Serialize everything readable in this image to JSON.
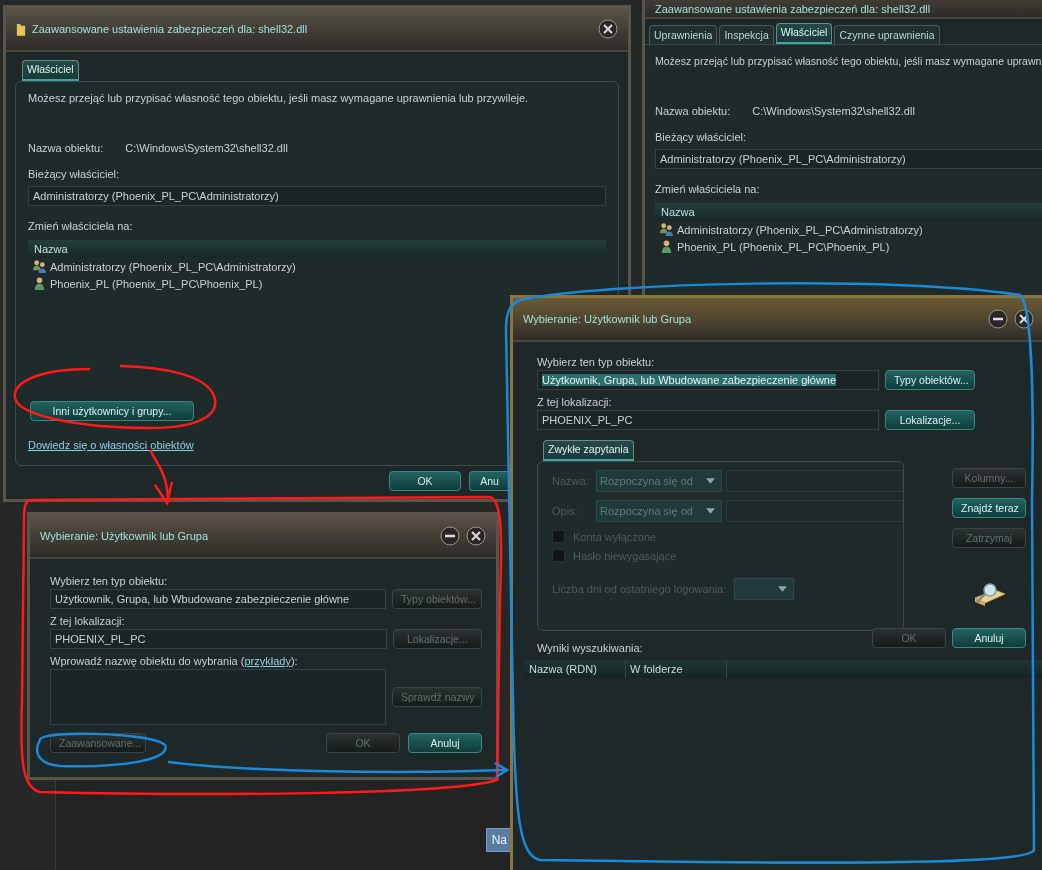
{
  "main_window": {
    "title": "Zaawansowane ustawienia zabezpieczeń dla: shell32.dll",
    "tabs": [
      {
        "label": "Właściciel",
        "selected": true
      }
    ],
    "description": "Możesz przejąć lub przypisać własność tego obiektu, jeśli masz wymagane uprawnienia lub przywileje.",
    "object_name_label": "Nazwa obiektu:",
    "object_name_value": "C:\\Windows\\System32\\shell32.dll",
    "current_owner_label": "Bieżący właściciel:",
    "current_owner_value": "Administratorzy (Phoenix_PL_PC\\Administratorzy)",
    "change_owner_label": "Zmień właściciela na:",
    "list_header": "Nazwa",
    "owners": [
      {
        "name": "Administratorzy (Phoenix_PL_PC\\Administratorzy)",
        "kind": "group"
      },
      {
        "name": "Phoenix_PL (Phoenix_PL_PC\\Phoenix_PL)",
        "kind": "user"
      }
    ],
    "other_users_button": "Inni użytkownicy i grupy...",
    "learn_link": "Dowiedz się o własności obiektów",
    "buttons": [
      "OK",
      "Anu"
    ]
  },
  "background_window": {
    "title": "Zaawansowane ustawienia zabezpieczeń dla: shell32.dll",
    "tabs": [
      {
        "label": "Uprawnienia",
        "selected": false
      },
      {
        "label": "Inspekcja",
        "selected": false
      },
      {
        "label": "Właściciel",
        "selected": true
      },
      {
        "label": "Czynne uprawnienia",
        "selected": false
      }
    ],
    "description": "Możesz przejąć lub przypisać własność tego obiektu, jeśli masz wymagane uprawn",
    "object_name_label": "Nazwa obiektu:",
    "object_name_value": "C:\\Windows\\System32\\shell32.dll",
    "current_owner_label": "Bieżący właściciel:",
    "current_owner_value": "Administratorzy (Phoenix_PL_PC\\Administratorzy)",
    "change_owner_label": "Zmień właściciela na:",
    "list_header": "Nazwa",
    "owners": [
      {
        "name": "Administratorzy (Phoenix_PL_PC\\Administratorzy)",
        "kind": "group"
      },
      {
        "name": "Phoenix_PL (Phoenix_PL_PC\\Phoenix_PL)",
        "kind": "user"
      }
    ]
  },
  "behind_window": {
    "button": "Na"
  },
  "small_select_dialog": {
    "title": "Wybieranie: Użytkownik lub Grupa",
    "object_type_label": "Wybierz ten typ obiektu:",
    "object_type_value": "Użytkownik, Grupa, lub Wbudowane zabezpieczenie główne",
    "object_types_button": {
      "label": "Typy obiektów...",
      "disabled": true
    },
    "location_label": "Z tej lokalizacji:",
    "location_value": "PHOENIX_PL_PC",
    "locations_button": {
      "label": "Lokalizacje...",
      "disabled": true
    },
    "names_label": "Wprowadź nazwę obiektu do wybrania (",
    "examples_link": "przykłady",
    "names_label_end": "):",
    "check_names_button": {
      "label": "Sprawdź nazwy",
      "disabled": true
    },
    "advanced_button": {
      "label": "Zaawansowane...",
      "disabled": true
    },
    "ok_button": {
      "label": "OK",
      "disabled": true
    },
    "cancel_button": {
      "label": "Anuluj",
      "disabled": false
    }
  },
  "select_dialog": {
    "title": "Wybieranie: Użytkownik lub Grupa",
    "object_type_label": "Wybierz ten typ obiektu:",
    "object_type_value": "Użytkownik, Grupa, lub Wbudowane zabezpieczenie główne",
    "object_type_text_selected": true,
    "object_types_button": {
      "label": "Typy obiektów...",
      "disabled": false
    },
    "location_label": "Z tej lokalizacji:",
    "location_value": "PHOENIX_PL_PC",
    "locations_button": {
      "label": "Lokalizacje...",
      "disabled": false
    },
    "query_tabs": [
      {
        "label": "Zwykłe zapytania",
        "selected": true
      }
    ],
    "query_disabled": true,
    "name_label": "Nazwa:",
    "name_operator": "Rozpoczyna się od",
    "description_label": "Opis:",
    "description_operator": "Rozpoczyna się od",
    "checkboxes": [
      {
        "label": "Konta wyłączone",
        "checked": false
      },
      {
        "label": "Hasło niewygasające",
        "checked": false
      }
    ],
    "days_label": "Liczba dni od ostatniego logowania:",
    "side_buttons": [
      {
        "label": "Kolumny...",
        "disabled": true
      },
      {
        "label": "Znajdź teraz",
        "disabled": false
      },
      {
        "label": "Zatrzymaj",
        "disabled": true
      }
    ],
    "ok_button": {
      "label": "OK",
      "disabled": true
    },
    "cancel_button": {
      "label": "Anuluj",
      "disabled": false
    },
    "results_label": "Wyniki wyszukiwania:",
    "results_columns": [
      "Nazwa (RDN)",
      "W folderze"
    ]
  }
}
